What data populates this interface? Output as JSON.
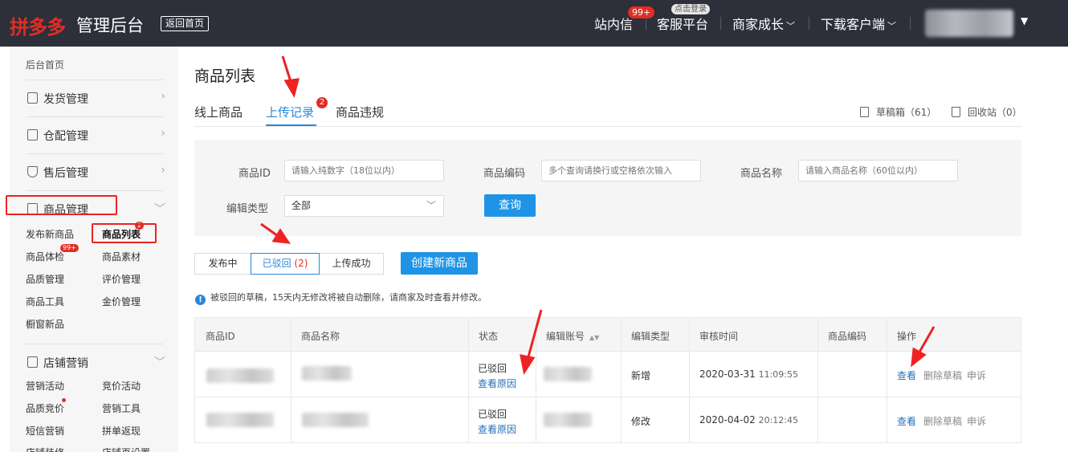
{
  "header": {
    "logo": "拼多多",
    "subtitle": "管理后台",
    "back_home": "返回首页",
    "nav": {
      "messages": "站内信",
      "messages_badge": "99+",
      "service": "客服平台",
      "service_badge": "点击登录",
      "growth": "商家成长",
      "download": "下载客户端"
    }
  },
  "sidebar": {
    "home": "后台首页",
    "groups": [
      "发货管理",
      "仓配管理",
      "售后管理",
      "商品管理",
      "店铺营销"
    ],
    "goods_items": [
      "发布新商品",
      "商品列表",
      "商品体检",
      "商品素材",
      "品质管理",
      "评价管理",
      "商品工具",
      "金价管理",
      "橱窗新品"
    ],
    "goods_list_badge": "2",
    "goods_check_badge": "99+",
    "marketing_items": [
      "营销活动",
      "竞价活动",
      "品质竞价",
      "营销工具",
      "短信营销",
      "拼单返现",
      "店铺装修",
      "店铺页设置"
    ]
  },
  "main": {
    "title": "商品列表",
    "tabs": [
      "线上商品",
      "上传记录",
      "商品违规"
    ],
    "tab_badge": "2",
    "drafts": "草稿箱（61）",
    "recycle": "回收站（0）",
    "filters": {
      "id_label": "商品ID",
      "id_placeholder": "请输入纯数字（18位以内）",
      "code_label": "商品编码",
      "code_placeholder": "多个查询请换行或空格依次输入",
      "name_label": "商品名称",
      "name_placeholder": "请输入商品名称（60位以内）",
      "type_label": "编辑类型",
      "type_value": "全部",
      "query_button": "查询"
    },
    "segments": [
      "发布中",
      "已驳回",
      "上传成功"
    ],
    "rejected_count": "(2)",
    "create_button": "创建新商品",
    "notice": "被驳回的草稿，15天内无修改将被自动删除，请商家及时查看并修改。",
    "table": {
      "headers": [
        "商品ID",
        "商品名称",
        "状态",
        "编辑账号",
        "编辑类型",
        "审核时间",
        "商品编码",
        "操作"
      ],
      "rows": [
        {
          "status": "已驳回",
          "reason": "查看原因",
          "type": "新增",
          "date": "2020-03-31",
          "time": "11:09:55",
          "view": "查看",
          "delete": "删除草稿",
          "appeal": "申诉"
        },
        {
          "status": "已驳回",
          "reason": "查看原因",
          "type": "修改",
          "date": "2020-04-02",
          "time": "20:12:45",
          "view": "查看",
          "delete": "删除草稿",
          "appeal": "申诉"
        }
      ]
    }
  },
  "colors": {
    "topbar": "#2d2f3b",
    "brand_red": "#e02e24",
    "accent_blue": "#2a87d8",
    "primary_button": "#1f94e6",
    "annotation_red": "#ee2222"
  }
}
